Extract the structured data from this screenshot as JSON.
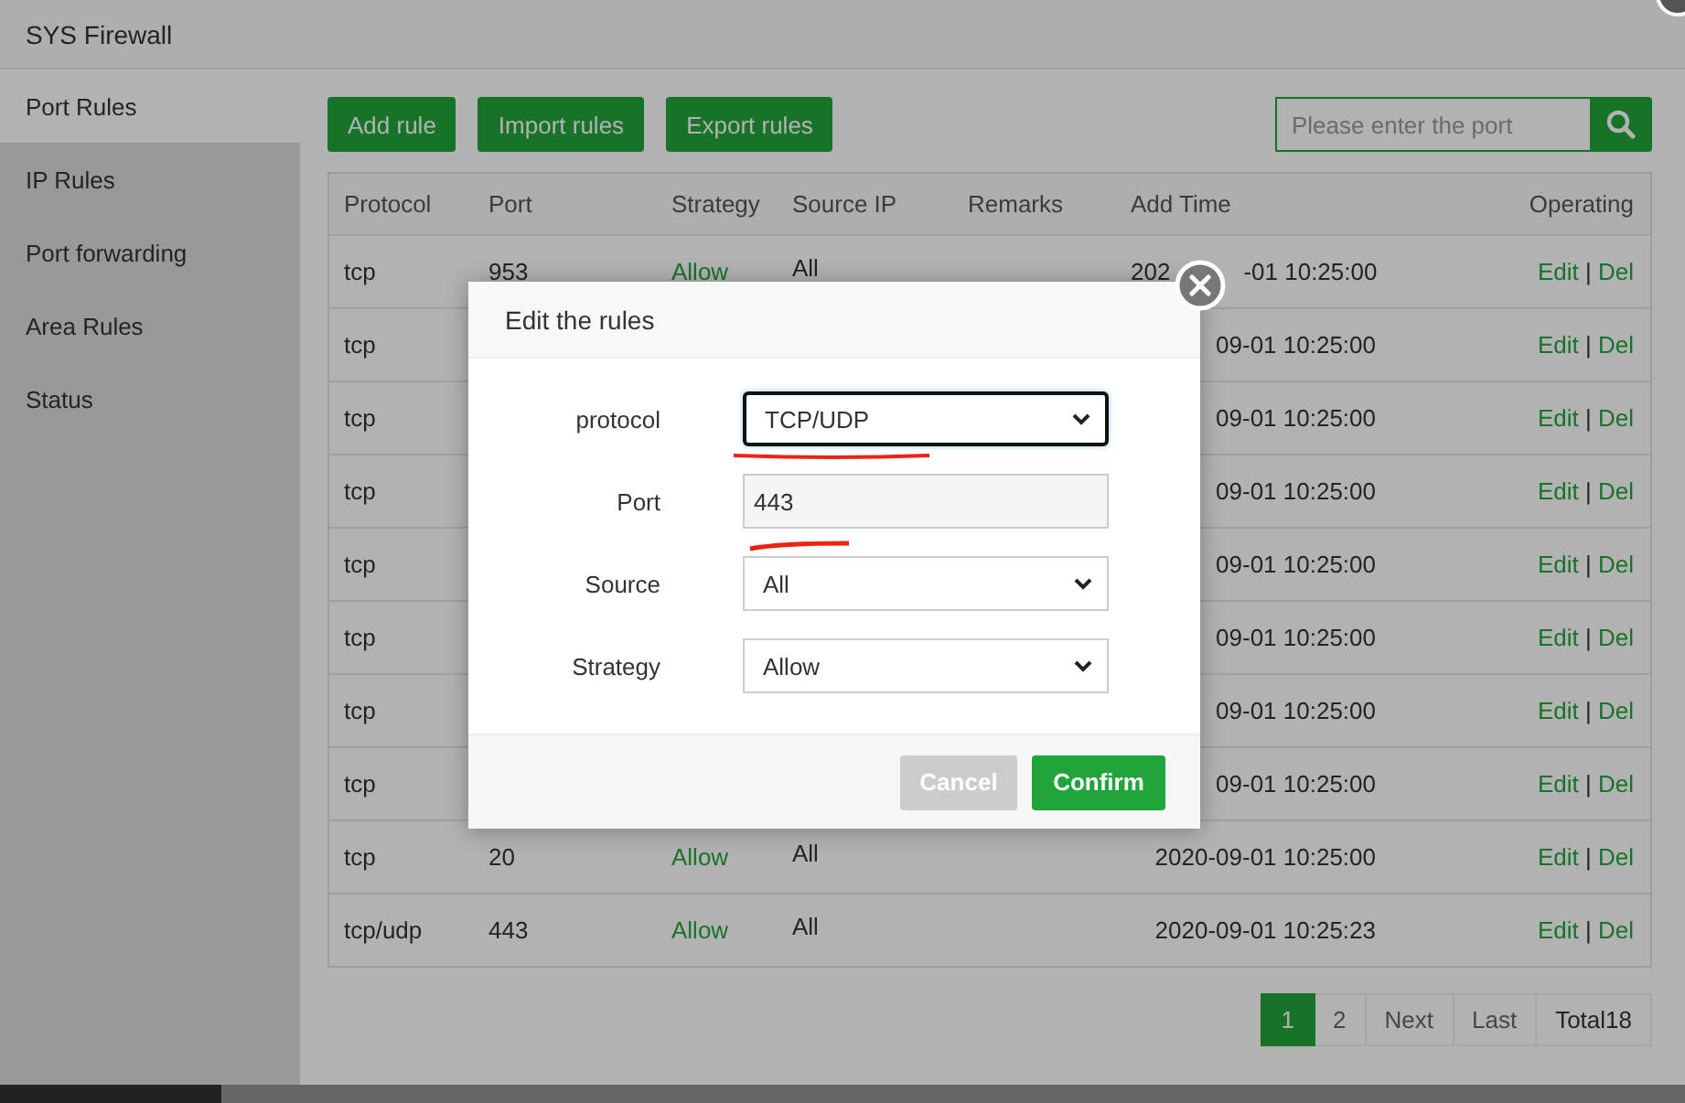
{
  "window": {
    "title": "SYS Firewall"
  },
  "sidebar": {
    "items": [
      {
        "label": "Port Rules",
        "selected": true
      },
      {
        "label": "IP Rules",
        "selected": false
      },
      {
        "label": "Port forwarding",
        "selected": false
      },
      {
        "label": "Area Rules",
        "selected": false
      },
      {
        "label": "Status",
        "selected": false
      }
    ]
  },
  "toolbar": {
    "buttons": [
      "Add rule",
      "Import rules",
      "Export rules"
    ],
    "search": {
      "placeholder": "Please enter the port"
    }
  },
  "table": {
    "columns": [
      "Protocol",
      "Port",
      "Strategy",
      "Source IP",
      "Remarks",
      "Add Time",
      "Operating"
    ],
    "rows": [
      {
        "protocol": "tcp",
        "port": "953",
        "strategy": "Allow",
        "source": "All",
        "time": [
          "202",
          "-01 10:25:00"
        ],
        "edit": "Edit",
        "sep": "|",
        "del": "Del"
      },
      {
        "protocol": "tcp",
        "time": "09-01 10:25:00",
        "edit": "Edit",
        "sep": "|",
        "del": "Del"
      },
      {
        "protocol": "tcp",
        "time": "09-01 10:25:00",
        "edit": "Edit",
        "sep": "|",
        "del": "Del"
      },
      {
        "protocol": "tcp",
        "time": "09-01 10:25:00",
        "edit": "Edit",
        "sep": "|",
        "del": "Del"
      },
      {
        "protocol": "tcp",
        "time": "09-01 10:25:00",
        "edit": "Edit",
        "sep": "|",
        "del": "Del"
      },
      {
        "protocol": "tcp",
        "time": "09-01 10:25:00",
        "edit": "Edit",
        "sep": "|",
        "del": "Del"
      },
      {
        "protocol": "tcp",
        "time": "09-01 10:25:00",
        "edit": "Edit",
        "sep": "|",
        "del": "Del"
      },
      {
        "protocol": "tcp",
        "time": "09-01 10:25:00",
        "edit": "Edit",
        "sep": "|",
        "del": "Del"
      },
      {
        "protocol": "tcp",
        "port": "20",
        "strategy": "Allow",
        "source": "All",
        "time": "2020-09-01 10:25:00",
        "edit": "Edit",
        "sep": "|",
        "del": "Del"
      },
      {
        "protocol": "tcp/udp",
        "port": "443",
        "strategy": "Allow",
        "source": "All",
        "time": "2020-09-01 10:25:23",
        "edit": "Edit",
        "sep": "|",
        "del": "Del"
      }
    ]
  },
  "pagination": {
    "pages": [
      {
        "label": "1",
        "selected": true
      },
      {
        "label": "2",
        "selected": false
      }
    ],
    "next": "Next",
    "last": "Last",
    "total": "Total18"
  },
  "dialog": {
    "title": "Edit the rules",
    "fields": [
      {
        "kind": "select",
        "label": "protocol",
        "value": "TCP/UDP",
        "focused": true
      },
      {
        "kind": "input",
        "label": "Port",
        "value": "443",
        "focused": false
      },
      {
        "kind": "select",
        "label": "Source",
        "value": "All",
        "focused": false
      },
      {
        "kind": "select",
        "label": "Strategy",
        "value": "Allow",
        "focused": false
      }
    ],
    "cancel": "Cancel",
    "confirm": "Confirm"
  }
}
